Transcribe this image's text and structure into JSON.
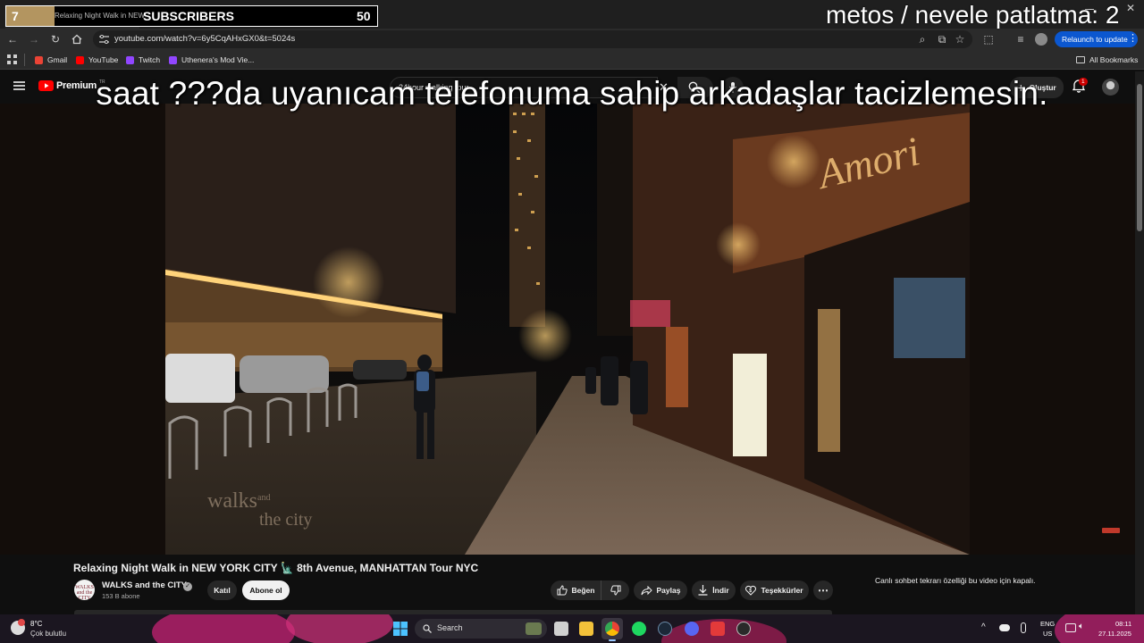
{
  "overlay": {
    "subscribers_count": "7",
    "subscribers_label": "SUBSCRIBERS",
    "subscribers_goal": "50",
    "counter_text": "metos / nevele patlatma: 2",
    "big_text": "saat ???da uyanıcam telefonuma sahip arkadaşlar tacizlemesin."
  },
  "browser": {
    "tab_title": "Relaxing Night Walk in NEW",
    "url": "youtube.com/watch?v=6y5CqAHxGX0&t=5024s",
    "relaunch_label": "Relaunch to update",
    "bookmarks": [
      {
        "label": "Gmail",
        "color": "#ea4335"
      },
      {
        "label": "YouTube",
        "color": "#ff0000"
      },
      {
        "label": "Twitch",
        "color": "#9146ff"
      },
      {
        "label": "Uthenera's Mod Vie...",
        "color": "#9146ff"
      }
    ],
    "all_bookmarks": "All Bookmarks"
  },
  "youtube": {
    "logo_label": "Premium",
    "logo_superscript": "TR",
    "search_value": "24hour walking tour",
    "create_label": "Oluştur",
    "notification_count": "1",
    "video_title": "Relaxing Night Walk in NEW YORK CITY 🗽 8th Avenue, MANHATTAN Tour NYC",
    "channel_name": "WALKS and the CITY",
    "channel_subs": "153 B abone",
    "channel_avatar_text": "WALKS and the CITY",
    "join_label": "Katıl",
    "subscribe_label": "Abone ol",
    "like_label": "Beğen",
    "share_label": "Paylaş",
    "download_label": "İndir",
    "thanks_label": "Teşekkürler",
    "chat_disabled": "Canlı sohbet tekrarı özelliği bu video için kapalı.",
    "watermark": "walks and the city"
  },
  "taskbar": {
    "weather_temp": "8°C",
    "weather_desc": "Çok bulutlu",
    "search_label": "Search",
    "lang_top": "ENG",
    "lang_bottom": "US",
    "time": "08:11",
    "date": "27.11.2025"
  },
  "colors": {
    "accent_blue": "#0b57d0",
    "youtube_red": "#ff0000",
    "subscriber_gold": "#c7a56a"
  }
}
